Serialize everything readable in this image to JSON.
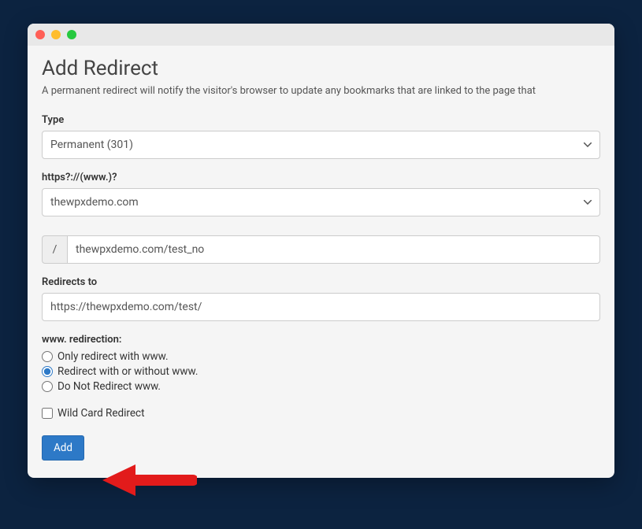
{
  "heading": "Add Redirect",
  "description": "A permanent redirect will notify the visitor's browser to update any bookmarks that are linked to the page that",
  "form": {
    "type_label": "Type",
    "type_value": "Permanent (301)",
    "domain_label": "https?://(www.)?",
    "domain_value": "thewpxdemo.com",
    "path_prefix": "/",
    "path_value": "thewpxdemo.com/test_no",
    "redirects_to_label": "Redirects to",
    "redirects_to_value": "https://thewpxdemo.com/test/",
    "www_label": "www. redirection:",
    "www_options": {
      "only": "Only redirect with www.",
      "both": "Redirect with or without www.",
      "none": "Do Not Redirect www."
    },
    "wildcard_label": "Wild Card Redirect",
    "submit_label": "Add"
  }
}
